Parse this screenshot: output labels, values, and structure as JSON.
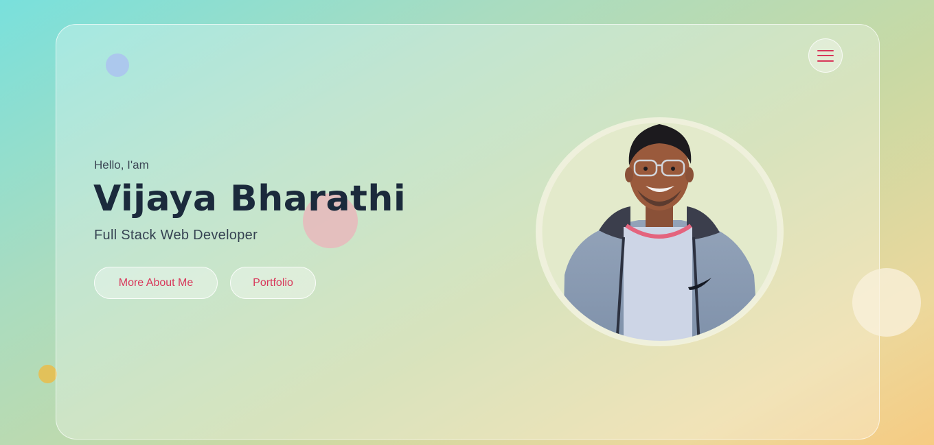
{
  "menu": {
    "icon": "hamburger-menu-icon",
    "accent": "#d8375a"
  },
  "hero": {
    "greeting": "Hello, I'am",
    "name": "Vijaya Bharathi",
    "role": "Full Stack Web Developer",
    "buttons": {
      "about_label": "More About Me",
      "portfolio_label": "Portfolio"
    }
  },
  "profile_photo": {
    "subject": "smiling man with glasses in grey hooded jacket"
  },
  "colors": {
    "accent": "#d8375a",
    "heading": "#1b2a3c",
    "text": "#364352"
  }
}
